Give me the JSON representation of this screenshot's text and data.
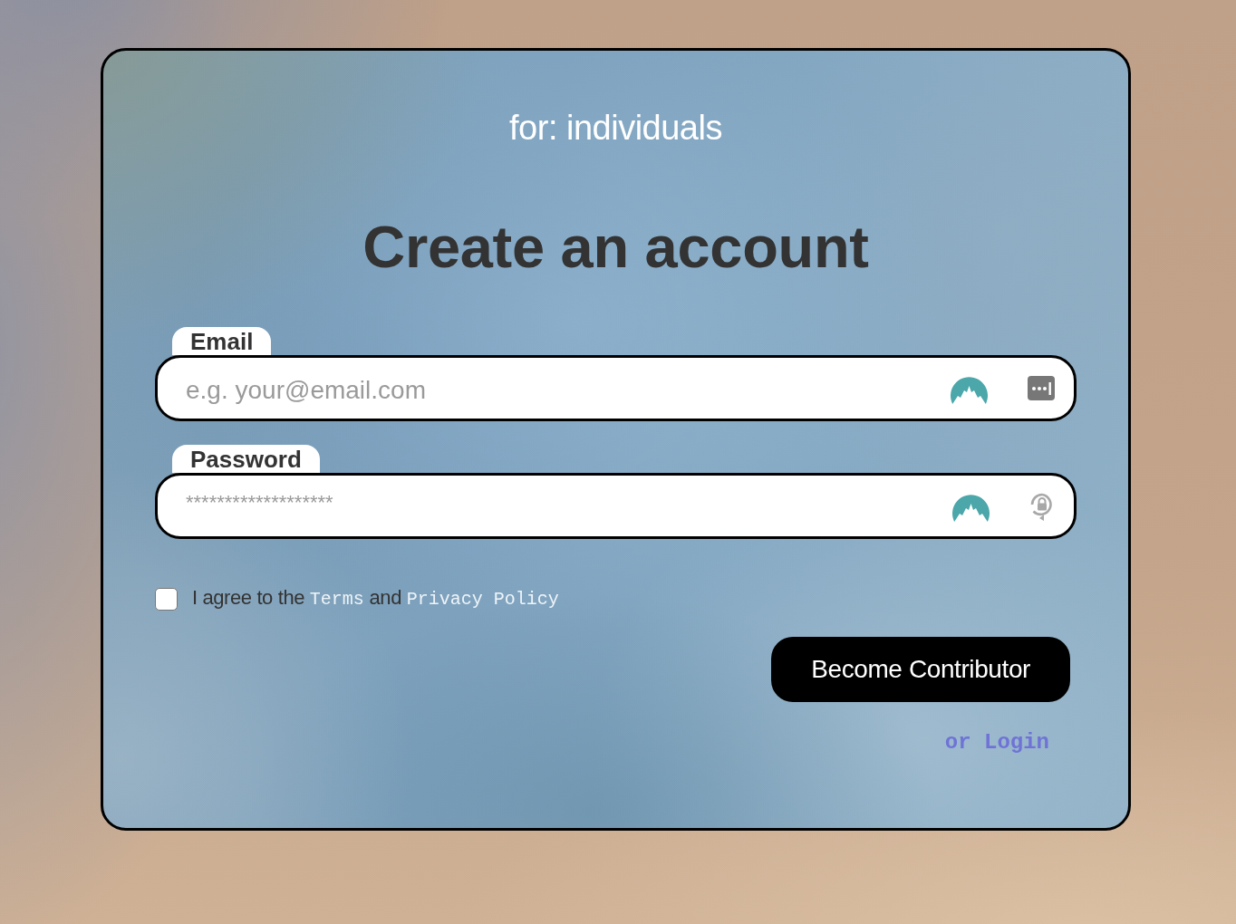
{
  "card": {
    "eyebrow": "for: individuals",
    "title": "Create an account"
  },
  "fields": [
    {
      "kind": "email",
      "label": "Email",
      "placeholder": "e.g. your@email.com"
    },
    {
      "kind": "password",
      "label": "Password",
      "placeholder": "*******************"
    }
  ],
  "agreement": {
    "checked": false,
    "parts": [
      {
        "kind": "text",
        "text": "I agree to the "
      },
      {
        "kind": "link",
        "text": "Terms"
      },
      {
        "kind": "text",
        "text": " and "
      },
      {
        "kind": "link",
        "text": "Privacy Policy"
      }
    ]
  },
  "submit_button": "Become Contributor",
  "login_link": "or Login"
}
